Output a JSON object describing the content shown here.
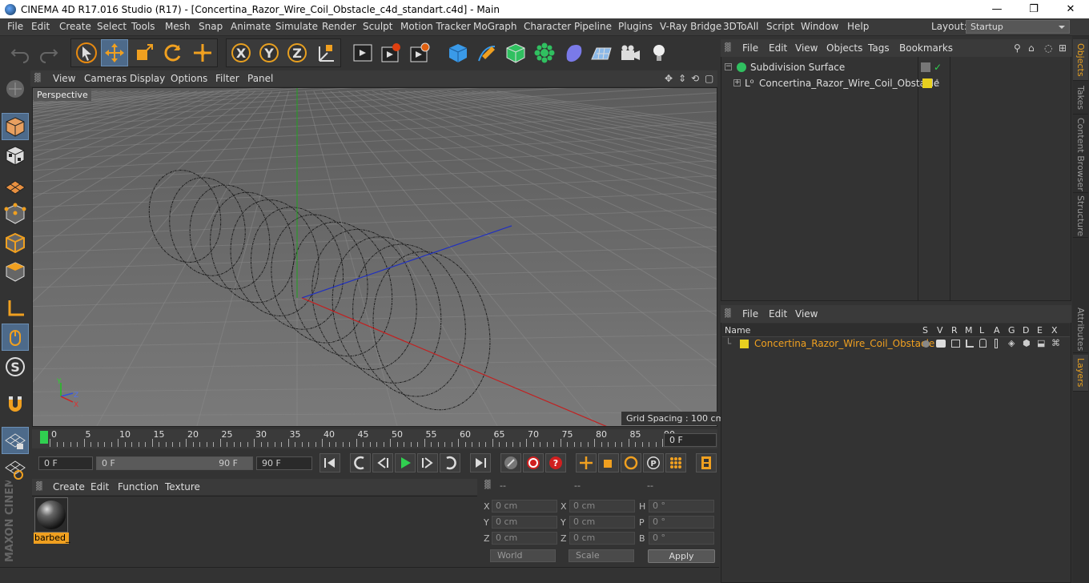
{
  "titlebar": {
    "title": "CINEMA 4D R17.016 Studio (R17) - [Concertina_Razor_Wire_Coil_Obstacle_c4d_standart.c4d] - Main",
    "minimize": "—",
    "restore": "❐",
    "close": "✕"
  },
  "menubar": {
    "items": [
      "File",
      "Edit",
      "Create",
      "Select",
      "Tools",
      "Mesh",
      "Snap",
      "Animate",
      "Simulate",
      "Render",
      "Sculpt",
      "Motion Tracker",
      "MoGraph",
      "Character",
      "Pipeline",
      "Plugins",
      "V-Ray Bridge",
      "3DToAll",
      "Script",
      "Window",
      "Help"
    ],
    "layout_label": "Layout:",
    "layout_value": "Startup"
  },
  "viewport": {
    "menu": [
      "View",
      "Cameras",
      "Display",
      "Options",
      "Filter",
      "Panel"
    ],
    "label": "Perspective",
    "grid_spacing": "Grid Spacing : 100 cm",
    "axis_labels": {
      "x": "X",
      "y": "Y",
      "z": "Z"
    },
    "colors": {
      "x_axis": "#c22020",
      "y_axis": "#20a020",
      "z_axis": "#2030c0",
      "bg_top": "#5c5c5c",
      "bg_bottom": "#7a7a7a"
    }
  },
  "timeline": {
    "ticks": [
      "0",
      "5",
      "10",
      "15",
      "20",
      "25",
      "30",
      "35",
      "40",
      "45",
      "50",
      "55",
      "60",
      "65",
      "70",
      "75",
      "80",
      "85",
      "90"
    ],
    "current_frame": "0 F"
  },
  "transport": {
    "start_field": "0 F",
    "slider_left": "0 F",
    "slider_right": "90 F",
    "end_field": "90 F"
  },
  "material_manager": {
    "menu": [
      "Create",
      "Edit",
      "Function",
      "Texture"
    ],
    "material_name": "barbed_"
  },
  "coordinates": {
    "headers": [
      "--",
      "--",
      "--"
    ],
    "rows": [
      {
        "l1": "X",
        "v1": "0 cm",
        "l2": "X",
        "v2": "0 cm",
        "l3": "H",
        "v3": "0 °"
      },
      {
        "l1": "Y",
        "v1": "0 cm",
        "l2": "Y",
        "v2": "0 cm",
        "l3": "P",
        "v3": "0 °"
      },
      {
        "l1": "Z",
        "v1": "0 cm",
        "l2": "Z",
        "v2": "0 cm",
        "l3": "B",
        "v3": "0 °"
      }
    ],
    "mode": "World",
    "scale": "Scale",
    "apply": "Apply"
  },
  "object_manager": {
    "menu": [
      "File",
      "Edit",
      "View",
      "Objects",
      "Tags",
      "Bookmarks"
    ],
    "objects": [
      {
        "name": "Subdivision Surface"
      },
      {
        "name": "Concertina_Razor_Wire_Coil_Obstacle"
      }
    ]
  },
  "layer_manager": {
    "menu": [
      "File",
      "Edit",
      "View"
    ],
    "columns": [
      "Name",
      "S",
      "V",
      "R",
      "M",
      "L",
      "A",
      "G",
      "D",
      "E",
      "X"
    ],
    "layers": [
      {
        "name": "Concertina_Razor_Wire_Coil_Obstacle",
        "color": "#e8d020"
      }
    ]
  },
  "right_tabs": [
    "Objects",
    "Takes",
    "Content Browser",
    "Structure",
    "Attributes",
    "Layers"
  ],
  "maxon_logo": "MAXON CINEMA 4D"
}
